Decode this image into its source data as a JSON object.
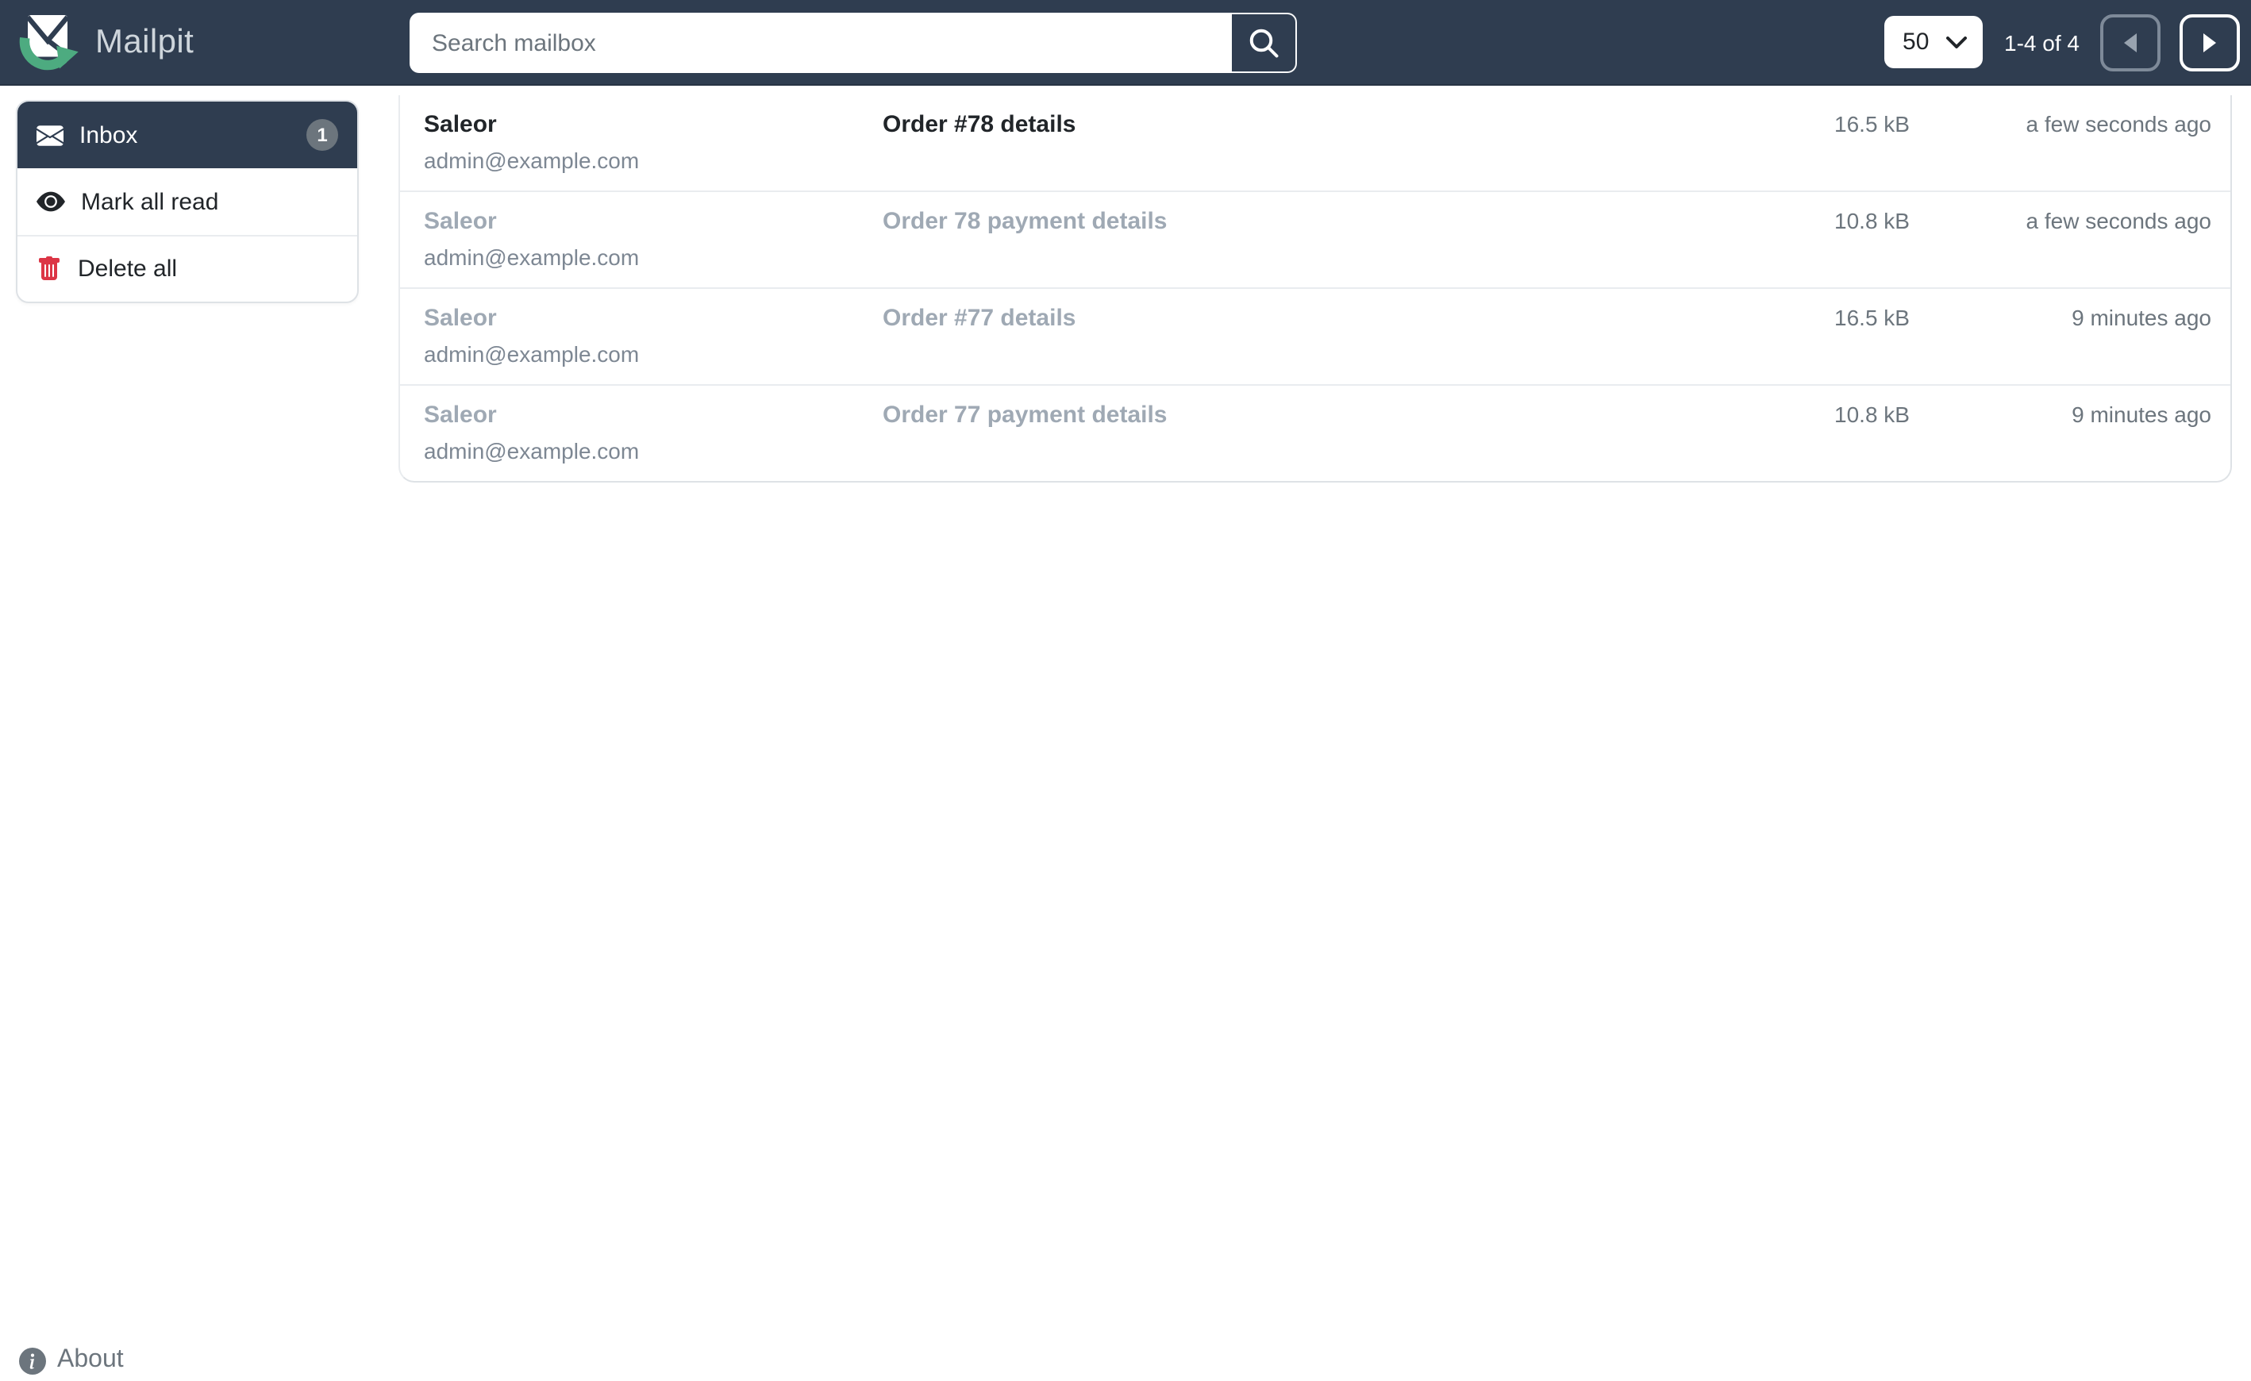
{
  "navbar": {
    "brand": "Mailpit",
    "search": {
      "placeholder": "Search mailbox",
      "value": ""
    },
    "per_page": "50",
    "pagination_label": "1-4 of 4"
  },
  "sidebar": {
    "inbox_label": "Inbox",
    "inbox_unread_count": "1",
    "mark_all_read_label": "Mark all read",
    "delete_all_label": "Delete all"
  },
  "messages": [
    {
      "from_name": "Saleor",
      "from_email": "admin@example.com",
      "subject": "Order #78 details",
      "size": "16.5 kB",
      "date": "a few seconds ago",
      "read": false
    },
    {
      "from_name": "Saleor",
      "from_email": "admin@example.com",
      "subject": "Order 78 payment details",
      "size": "10.8 kB",
      "date": "a few seconds ago",
      "read": true
    },
    {
      "from_name": "Saleor",
      "from_email": "admin@example.com",
      "subject": "Order #77 details",
      "size": "16.5 kB",
      "date": "9 minutes ago",
      "read": true
    },
    {
      "from_name": "Saleor",
      "from_email": "admin@example.com",
      "subject": "Order 77 payment details",
      "size": "10.8 kB",
      "date": "9 minutes ago",
      "read": true
    }
  ],
  "footer": {
    "about_label": "About"
  },
  "colors": {
    "navbar_bg": "#2f3d50",
    "logo_green": "#4dab80",
    "badge_bg": "#6c757d",
    "danger_red": "#dc3545",
    "unread_text": "#212529",
    "read_text": "#9fa9b4",
    "muted_text": "#6c757d"
  }
}
